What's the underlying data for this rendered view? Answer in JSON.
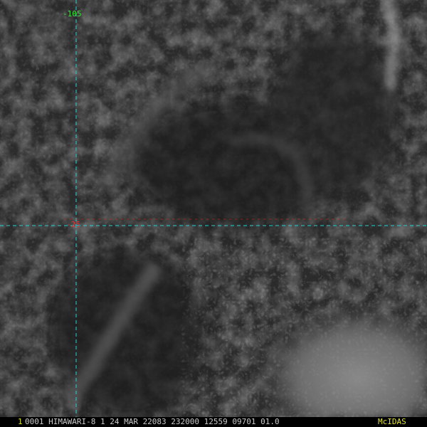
{
  "overlay": {
    "longitude_label": "-105",
    "latitude_label": "-25"
  },
  "status_bar": {
    "frame_number": "1",
    "info_text": "0001 HIMAWARI-8  1 24 MAR 22083 232000 12559 09701 01.0",
    "logo_text": "McIDAS"
  },
  "colors": {
    "grid_line": "#27d3d3",
    "grid_center": "#d02020",
    "lon_label": "#3ce03c",
    "lat_label": "#e03030",
    "frame_number": "#e0e030",
    "status_text": "#c9c9c9",
    "logo": "#e0e030"
  }
}
